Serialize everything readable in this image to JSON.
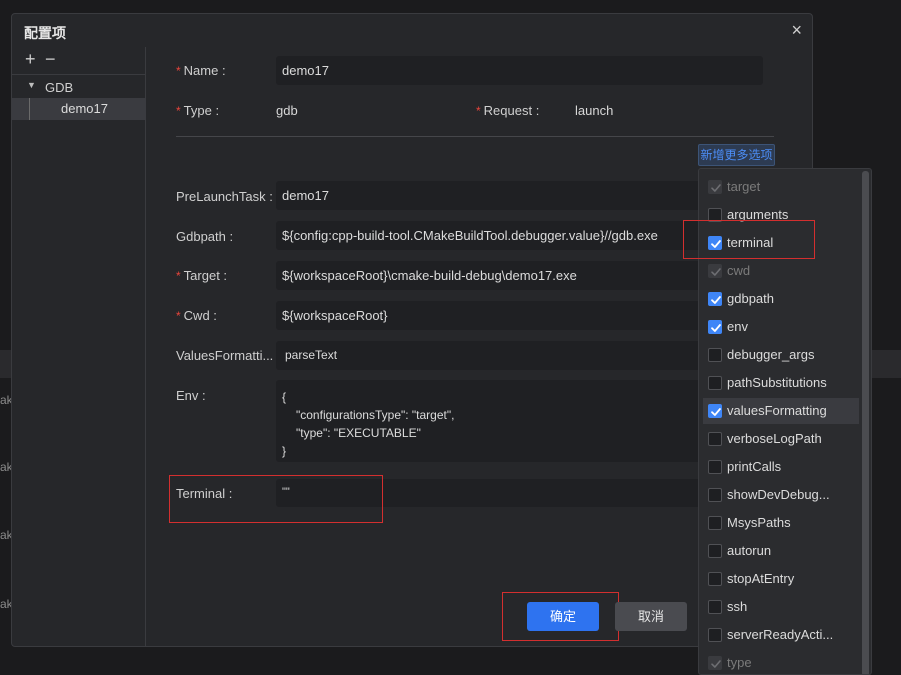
{
  "background": {
    "fragments": [
      "ak",
      "ak",
      "ak",
      "ak"
    ]
  },
  "dialog": {
    "title": "配置项",
    "close_glyph": "×"
  },
  "sidebar": {
    "add_glyph": "+",
    "remove_glyph": "−",
    "group_label": "GDB",
    "items": [
      {
        "label": "demo17"
      }
    ]
  },
  "form": {
    "required_mark": "*",
    "name": {
      "label": "Name :",
      "value": "demo17"
    },
    "type": {
      "label": "Type :",
      "value": "gdb"
    },
    "request": {
      "label": "Request :",
      "value": "launch"
    },
    "add_more_options": "新增更多选项",
    "prelaunch": {
      "label": "PreLaunchTask :",
      "value": "demo17"
    },
    "gdbpath": {
      "label": "Gdbpath :",
      "value": "${config:cpp-build-tool.CMakeBuildTool.debugger.value}//gdb.exe"
    },
    "target": {
      "label": "Target :",
      "value": "${workspaceRoot}\\cmake-build-debug\\demo17.exe"
    },
    "cwd": {
      "label": "Cwd :",
      "value": "${workspaceRoot}"
    },
    "values_formatting": {
      "label": "ValuesFormatti...",
      "value": "parseText"
    },
    "env": {
      "label": "Env :",
      "lines": [
        "{",
        "\"configurationsType\": \"target\",",
        "\"type\": \"EXECUTABLE\"",
        "}"
      ]
    },
    "terminal": {
      "label": "Terminal :",
      "value": "\"\""
    }
  },
  "buttons": {
    "ok": "确定",
    "cancel": "取消"
  },
  "dropdown": {
    "items": [
      {
        "label": "target",
        "state": "disabled"
      },
      {
        "label": "arguments",
        "state": "unchecked"
      },
      {
        "label": "terminal",
        "state": "checked"
      },
      {
        "label": "cwd",
        "state": "disabled"
      },
      {
        "label": "gdbpath",
        "state": "checked"
      },
      {
        "label": "env",
        "state": "checked"
      },
      {
        "label": "debugger_args",
        "state": "unchecked"
      },
      {
        "label": "pathSubstitutions",
        "state": "unchecked"
      },
      {
        "label": "valuesFormatting",
        "state": "checked"
      },
      {
        "label": "verboseLogPath",
        "state": "unchecked"
      },
      {
        "label": "printCalls",
        "state": "unchecked"
      },
      {
        "label": "showDevDebug...",
        "state": "unchecked"
      },
      {
        "label": "MsysPaths",
        "state": "unchecked"
      },
      {
        "label": "autorun",
        "state": "unchecked"
      },
      {
        "label": "stopAtEntry",
        "state": "unchecked"
      },
      {
        "label": "ssh",
        "state": "unchecked"
      },
      {
        "label": "serverReadyActi...",
        "state": "unchecked"
      },
      {
        "label": "type",
        "state": "disabled"
      }
    ]
  },
  "colors": {
    "accent": "#3f86f7",
    "required": "#e8453c",
    "highlight_box": "#d32f2f"
  }
}
